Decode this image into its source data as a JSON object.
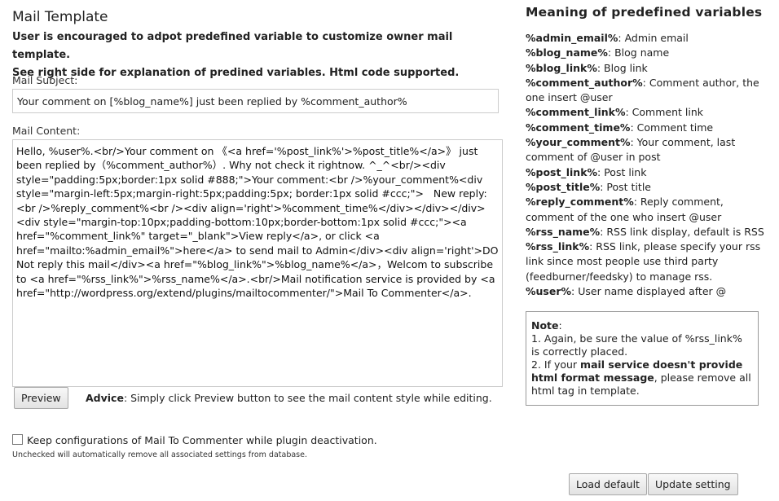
{
  "header": {
    "title": "Mail Template",
    "intro_line1": "User is encouraged to adpot predefined variable to customize owner mail template.",
    "intro_line2": "See right side for explanation of predined variables. Html code supported."
  },
  "form": {
    "subject_label": "Mail Subject:",
    "subject_value": "Your comment on [%blog_name%] just been replied by %comment_author%",
    "content_label": "Mail Content:",
    "content_value": "Hello, %user%.<br/>Your comment on 《<a href='%post_link%'>%post_title%</a>》 just been replied by（%comment_author%）. Why not check it rightnow. ^_^<br/><div style=\"padding:5px;border:1px solid #888;\">Your comment:<br />%your_comment%<div style=\"margin-left:5px;margin-right:5px;padding:5px; border:1px solid #ccc;\">   New reply:<br />%reply_comment%<br /><div align='right'>%comment_time%</div></div></div><div style=\"margin-top:10px;padding-bottom:10px;border-bottom:1px solid #ccc;\"><a href=\"%comment_link%\" target=\"_blank\">View reply</a>, or click <a href=\"mailto:%admin_email%\">here</a> to send mail to Admin</div><div align='right'>DO Not reply this mail</div><a href=\"%blog_link%\">%blog_name%</a>，Welcom to subscribe to <a href=\"%rss_link%\">%rss_name%</a>.<br/>Mail notification service is provided by <a href=\"http://wordpress.org/extend/plugins/mailtocommenter/\">Mail To Commenter</a>.",
    "preview_label": "Preview",
    "advice_bold": "Advice",
    "advice_text": ": Simply click Preview button to see the mail content style while editing.",
    "keep_label": "Keep configurations of Mail To Commenter while plugin deactivation.",
    "keep_checked": false,
    "keep_note": "Unchecked will automatically remove all associated settings from database."
  },
  "sidebar": {
    "title": "Meaning of predefined variables",
    "variables": [
      {
        "name": "%admin_email%",
        "desc": ":  Admin email"
      },
      {
        "name": "%blog_name%",
        "desc": ":  Blog name"
      },
      {
        "name": "%blog_link%",
        "desc": ":  Blog link"
      },
      {
        "name": "%comment_author%",
        "desc": ":  Comment author, the one insert @user"
      },
      {
        "name": "%comment_link%",
        "desc": ":  Comment link"
      },
      {
        "name": "%comment_time%",
        "desc": ":  Comment time"
      },
      {
        "name": "%your_comment%",
        "desc": ":  Your comment, last comment of @user in post"
      },
      {
        "name": "%post_link%",
        "desc": ":  Post link"
      },
      {
        "name": "%post_title%",
        "desc": ":  Post title"
      },
      {
        "name": "%reply_comment%",
        "desc": ":  Reply comment, comment of the one who insert @user"
      },
      {
        "name": "%rss_name%",
        "desc": ":  RSS link display, default is RSS"
      },
      {
        "name": "%rss_link%",
        "desc": ":  RSS link, please specify your rss link since most people use third party (feedburner/feedsky) to manage rss."
      },
      {
        "name": "%user%",
        "desc": ":  User name displayed after @"
      }
    ],
    "note": {
      "heading": "Note",
      "heading_suffix": ":",
      "line1": "1. Again, be sure the value of %rss_link% is correctly placed.",
      "line2_pre": "2. If your ",
      "line2_bold": "mail service doesn't provide html format message",
      "line2_post": ", please remove all html tag in template."
    }
  },
  "actions": {
    "load_default_label": "Load default",
    "update_label": "Update setting"
  }
}
